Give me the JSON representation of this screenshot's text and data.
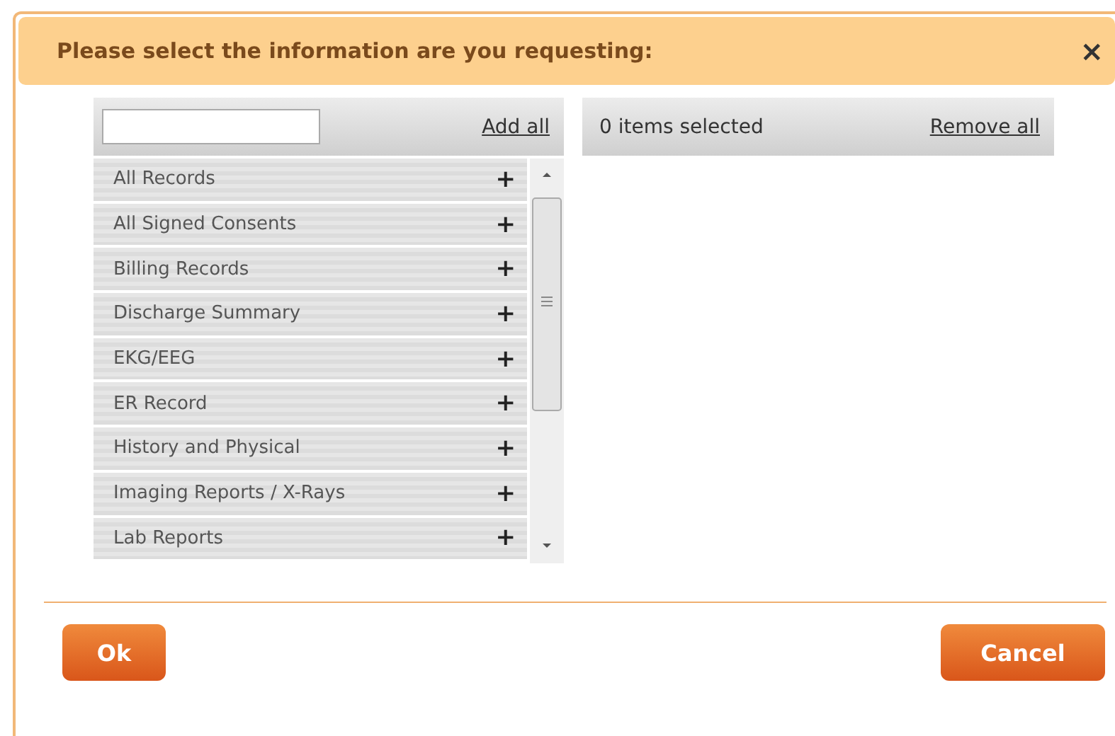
{
  "dialog": {
    "title": "Please select the information are you requesting:",
    "close": "×"
  },
  "available": {
    "add_all": "Add all",
    "items": [
      {
        "label": "All Records",
        "add": "+"
      },
      {
        "label": "All Signed Consents",
        "add": "+"
      },
      {
        "label": "Billing Records",
        "add": "+"
      },
      {
        "label": "Discharge Summary",
        "add": "+"
      },
      {
        "label": "EKG/EEG",
        "add": "+"
      },
      {
        "label": "ER Record",
        "add": "+"
      },
      {
        "label": "History and Physical",
        "add": "+"
      },
      {
        "label": "Imaging Reports / X-Rays",
        "add": "+"
      },
      {
        "label": "Lab Reports",
        "add": "+"
      }
    ]
  },
  "selected": {
    "count": "0 items selected",
    "remove_all": "Remove all"
  },
  "buttons": [
    "Ok",
    "Cancel"
  ]
}
